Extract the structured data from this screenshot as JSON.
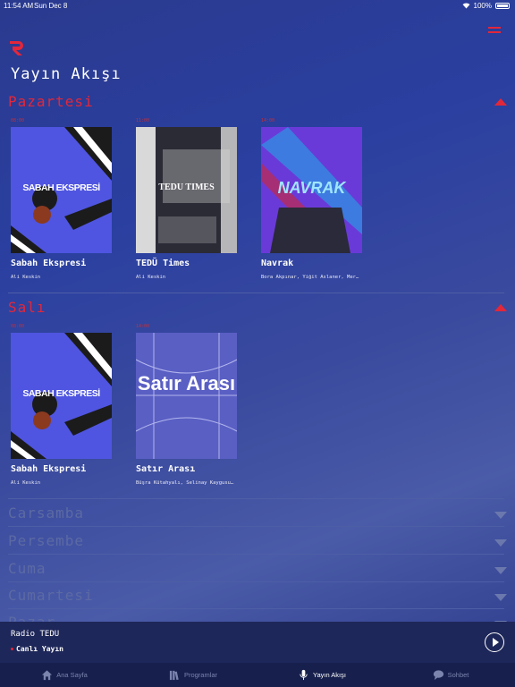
{
  "status_bar": {
    "time": "11:54 AM",
    "date": "Sun Dec 8",
    "battery": "100%"
  },
  "page_title": "Yayın Akışı",
  "days": [
    {
      "name": "Pazartesi",
      "expanded": true,
      "programs": [
        {
          "time": "08:00",
          "title": "Sabah Ekspresi",
          "hosts": "Ali Keskin",
          "art_text": "SABAH EKSPRESİ",
          "art_colors": [
            "#4f55e0",
            "#1b1b1b"
          ]
        },
        {
          "time": "11:00",
          "title": "TEDÜ Times",
          "hosts": "Ali Keskin",
          "art_text": "TEDU TIMES",
          "art_colors": [
            "#2b2b36",
            "#d9d9d9"
          ]
        },
        {
          "time": "14:00",
          "title": "Navrak",
          "hosts": "Bora Akpınar, Yiğit Aslaner, Mer…",
          "art_text": "NAVRAK",
          "art_colors": [
            "#6a3ad8",
            "#3d7be0"
          ]
        }
      ]
    },
    {
      "name": "Salı",
      "expanded": true,
      "programs": [
        {
          "time": "08:00",
          "title": "Sabah Ekspresi",
          "hosts": "Ali Keskin",
          "art_text": "SABAH EKSPRESİ",
          "art_colors": [
            "#4f55e0",
            "#1b1b1b"
          ]
        },
        {
          "time": "14:00",
          "title": "Satır Arası",
          "hosts": "Büşra Kütahyalı, Selinay Kaygusu…",
          "art_text": "Satır Arası",
          "art_colors": [
            "#5a5fc4",
            "#ffffff"
          ]
        }
      ]
    },
    {
      "name": "Carsamba",
      "expanded": false
    },
    {
      "name": "Persembe",
      "expanded": false
    },
    {
      "name": "Cuma",
      "expanded": false
    },
    {
      "name": "Cumartesi",
      "expanded": false
    },
    {
      "name": "Pazar",
      "expanded": false
    }
  ],
  "player": {
    "station": "Radio TEDU",
    "status": "Canlı Yayın"
  },
  "tabs": [
    {
      "label": "Ana Sayfa",
      "icon": "home-icon"
    },
    {
      "label": "Programlar",
      "icon": "library-icon"
    },
    {
      "label": "Yayın Akışı",
      "icon": "microphone-icon",
      "active": true
    },
    {
      "label": "Sohbet",
      "icon": "chat-icon"
    }
  ],
  "colors": {
    "accent": "#e3273a",
    "background": "#2a3fa0",
    "player_bg": "#1e2759",
    "tabbar_bg": "#17204d"
  }
}
